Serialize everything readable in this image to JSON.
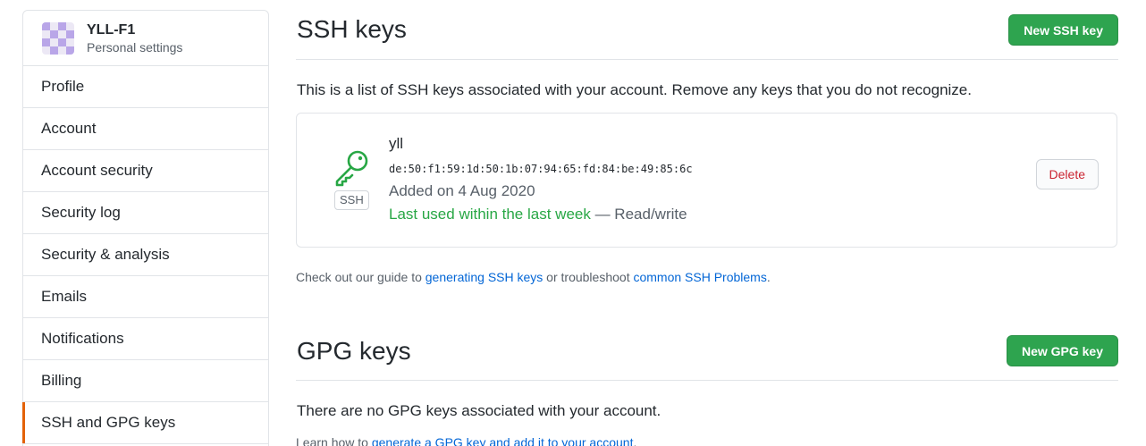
{
  "sidebar": {
    "user": {
      "name": "YLL-F1",
      "subtitle": "Personal settings"
    },
    "items": [
      {
        "label": "Profile"
      },
      {
        "label": "Account"
      },
      {
        "label": "Account security"
      },
      {
        "label": "Security log"
      },
      {
        "label": "Security & analysis"
      },
      {
        "label": "Emails"
      },
      {
        "label": "Notifications"
      },
      {
        "label": "Billing"
      },
      {
        "label": "SSH and GPG keys",
        "selected": true
      }
    ]
  },
  "ssh": {
    "title": "SSH keys",
    "new_button": "New SSH key",
    "description": "This is a list of SSH keys associated with your account. Remove any keys that you do not recognize.",
    "key": {
      "name": "yll",
      "fingerprint": "de:50:f1:59:1d:50:1b:07:94:65:fd:84:be:49:85:6c",
      "type_label": "SSH",
      "added": "Added on 4 Aug 2020",
      "last_used": "Last used within the last week",
      "access": " — Read/write",
      "delete_label": "Delete"
    },
    "guide": {
      "prefix": "Check out our guide to ",
      "link1": "generating SSH keys",
      "middle": " or troubleshoot ",
      "link2": "common SSH Problems",
      "suffix": "."
    }
  },
  "gpg": {
    "title": "GPG keys",
    "new_button": "New GPG key",
    "description": "There are no GPG keys associated with your account.",
    "learn": {
      "prefix": "Learn how to ",
      "link": "generate a GPG key and add it to your account",
      "suffix": "."
    }
  },
  "colors": {
    "green_button": "#2ea44f",
    "selected_accent": "#e36209",
    "link": "#0366d6",
    "delete_text": "#cb2431",
    "key_icon": "#28a745"
  }
}
